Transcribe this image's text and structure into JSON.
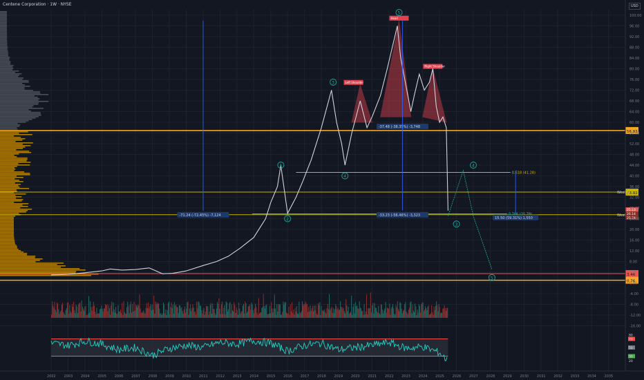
{
  "header": {
    "title": "Centene Corporation · 1W · NYSE",
    "currency": "USD"
  },
  "colors": {
    "background": "#131722",
    "up": "#26a69a",
    "down": "#ef5350",
    "orange": "#f5a623",
    "yellow": "#c8b400",
    "cyan": "#22d3c5",
    "pattern_red": "#e0414f",
    "blue_arrow": "#2962ff"
  },
  "chart_data": [
    {
      "type": "line",
      "symbol": "CNC",
      "timeframe": "1W",
      "price_scale": "log",
      "x_range": [
        2002,
        2036
      ],
      "x_ticks": [
        "2002",
        "2003",
        "2004",
        "2005",
        "2006",
        "2007",
        "2008",
        "2009",
        "2010",
        "2011",
        "2012",
        "2013",
        "2014",
        "2015",
        "2016",
        "2017",
        "2018",
        "2019",
        "2020",
        "2021",
        "2022",
        "2023",
        "2024",
        "2025",
        "2026",
        "2027",
        "2028",
        "2029",
        "2030",
        "2031",
        "2032",
        "2033",
        "2034",
        "2035"
      ],
      "y_ticks": [
        "100.00",
        "96.00",
        "92.00",
        "88.00",
        "84.00",
        "80.00",
        "76.00",
        "72.00",
        "68.00",
        "64.00",
        "60.00",
        "56.00",
        "52.00",
        "48.00",
        "44.00",
        "40.00",
        "36.00",
        "32.00",
        "28.00",
        "24.00",
        "20.00",
        "16.00",
        "12.00",
        "8.00",
        "4.00",
        "0.00",
        "-4.00",
        "-8.00",
        "-12.00",
        "-16.00"
      ],
      "series": [
        {
          "name": "",
          "x": [
            2002.0,
            2003.0,
            2004.0,
            2005.0,
            2005.5,
            2006.2,
            2007.0,
            2007.8,
            2008.6,
            2009.2,
            2010.0,
            2011.0,
            2011.8,
            2012.5,
            2013.2,
            2014.0,
            2014.7,
            2015.0,
            2015.4,
            2015.6,
            2016.0,
            2016.5,
            2016.9,
            2017.4,
            2018.0,
            2018.6,
            2018.9,
            2019.2,
            2019.4,
            2019.8,
            2020.3,
            2020.7,
            2021.0,
            2021.5,
            2021.9,
            2022.2,
            2022.5,
            2022.7,
            2023.0,
            2023.3,
            2023.5,
            2023.8,
            2024.1,
            2024.4,
            2024.6,
            2024.8,
            2025.0,
            2025.2,
            2025.4,
            2025.5
          ],
          "y": [
            3.0,
            3.2,
            3.8,
            4.5,
            5.2,
            4.8,
            5.0,
            5.6,
            3.4,
            3.6,
            4.5,
            6.5,
            8.0,
            10.0,
            13.0,
            17.0,
            24.0,
            30.0,
            36.0,
            44.0,
            26.0,
            32.0,
            38.0,
            46.0,
            58.0,
            72.0,
            60.0,
            52.0,
            44.0,
            56.0,
            68.0,
            58.0,
            62.0,
            70.0,
            80.0,
            88.0,
            96.0,
            84.0,
            74.0,
            64.0,
            70.0,
            78.0,
            72.0,
            75.0,
            80.0,
            66.0,
            60.0,
            62.0,
            58.0,
            27.0
          ]
        }
      ],
      "projection": {
        "x": [
          2025.5,
          2026.4,
          2027.0,
          2028.1
        ],
        "y": [
          25.0,
          42.0,
          25.0,
          5.0
        ]
      },
      "levels": [
        {
          "price": 56.93,
          "label": "56.93",
          "kind": "orange"
        },
        {
          "price": 33.92,
          "label": "33.92",
          "kind": "weekly"
        },
        {
          "price": 25.47,
          "label": "25.47",
          "kind": "weekly"
        },
        {
          "price": 3.5,
          "label": "3.46",
          "kind": "red"
        },
        {
          "price": 1.0,
          "label": "0.76",
          "kind": "orange"
        }
      ],
      "fib_lines": [
        {
          "price": 41.28,
          "x_start": 2016.5,
          "x_end": 2029.2,
          "label": "0.618 (41.28)"
        },
        {
          "price": 25.79,
          "x_start": 2013.9,
          "x_end": 2029.0,
          "label": "0.786 (25.79)"
        }
      ],
      "weekly_label": "Weekly",
      "price_tags": [
        "25.13",
        "26.14",
        "25.74"
      ],
      "measurements": [
        {
          "label": "-71.24 (-72.45%) -7,124",
          "x": 2011.0,
          "top": 98.0,
          "bottom": 27.0
        },
        {
          "label": "-37.48 (-38.35%) -3,748",
          "x": 2022.8,
          "top": 98.0,
          "bottom": 60.0
        },
        {
          "label": "-33.23 (-56.46%) -3,323",
          "x": 2022.8,
          "top": 60.0,
          "bottom": 27.0
        },
        {
          "label": "15.50 (59.31%) 1,550",
          "x": 2029.5,
          "top": 42.0,
          "bottom": 26.0
        }
      ],
      "head_shoulders": {
        "left_shoulder": "Left Shoulder",
        "head": "Head",
        "right_shoulder": "Right Shoulder"
      },
      "wave_labels": [
        {
          "label": "1",
          "x": 2015.6,
          "y": 44.0
        },
        {
          "label": "2",
          "x": 2016.0,
          "y": 24.0
        },
        {
          "label": "3",
          "x": 2018.7,
          "y": 75.0
        },
        {
          "label": "4",
          "x": 2019.4,
          "y": 40.0
        },
        {
          "label": "5",
          "x": 2022.6,
          "y": 101.0
        },
        {
          "label": "3",
          "x": 2026.0,
          "y": 22.0
        },
        {
          "label": "4",
          "x": 2027.0,
          "y": 44.0
        },
        {
          "label": "5",
          "x": 2028.1,
          "y": 2.0
        }
      ],
      "volume_profile_left": true
    },
    {
      "type": "line",
      "name": "",
      "x_range": [
        2002,
        2025.5
      ],
      "overbought": 70,
      "oversold": 30,
      "y_ticks": [
        "80",
        "70",
        "50",
        "30",
        "20"
      ],
      "series": [
        {
          "name": "",
          "x": [
            2002,
            2003,
            2004,
            2005,
            2006,
            2007,
            2008,
            2009,
            2010,
            2011,
            2012,
            2013,
            2014,
            2015,
            2016,
            2017,
            2018,
            2019,
            2020,
            2021,
            2022,
            2023,
            2024,
            2025,
            2025.5
          ],
          "y": [
            60,
            55,
            65,
            58,
            45,
            50,
            32,
            48,
            55,
            50,
            62,
            58,
            66,
            60,
            42,
            55,
            60,
            45,
            50,
            55,
            62,
            48,
            52,
            38,
            18
          ]
        }
      ]
    }
  ]
}
